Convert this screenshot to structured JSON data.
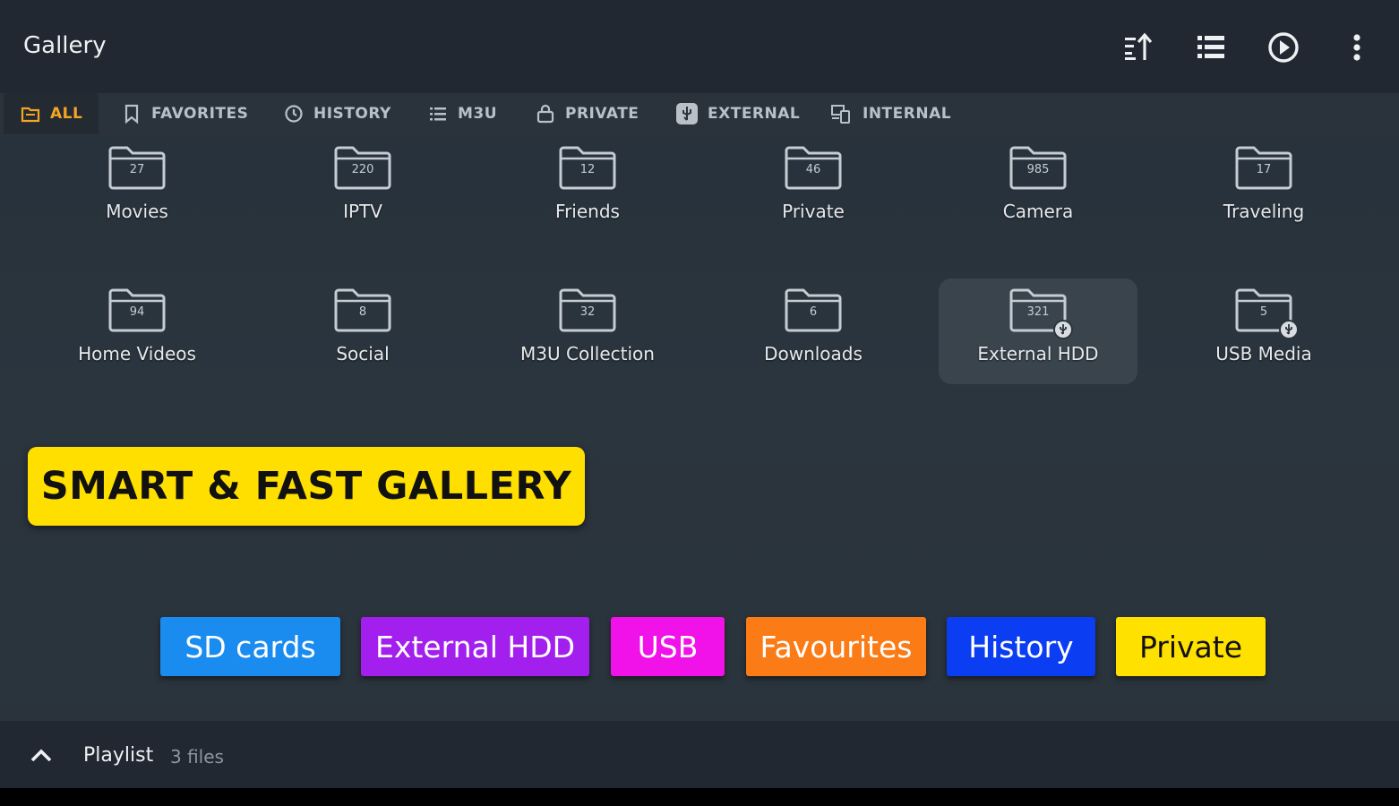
{
  "header": {
    "title": "Gallery",
    "actions": [
      {
        "name": "sort-icon"
      },
      {
        "name": "list-view-icon"
      },
      {
        "name": "play-circle-icon"
      },
      {
        "name": "more-vert-icon"
      }
    ]
  },
  "tabs": [
    {
      "label": "ALL",
      "icon": "folder-icon",
      "active": true
    },
    {
      "label": "FAVORITES",
      "icon": "bookmark-icon"
    },
    {
      "label": "HISTORY",
      "icon": "clock-icon"
    },
    {
      "label": "M3U",
      "icon": "list-icon"
    },
    {
      "label": "PRIVATE",
      "icon": "lock-icon"
    },
    {
      "label": "EXTERNAL",
      "icon": "usb-icon"
    },
    {
      "label": "INTERNAL",
      "icon": "devices-icon"
    }
  ],
  "folders": [
    {
      "name": "Movies",
      "count": "27"
    },
    {
      "name": "IPTV",
      "count": "220"
    },
    {
      "name": "Friends",
      "count": "12"
    },
    {
      "name": "Private",
      "count": "46"
    },
    {
      "name": "Camera",
      "count": "985"
    },
    {
      "name": "Traveling",
      "count": "17"
    },
    {
      "name": "Home Videos",
      "count": "94"
    },
    {
      "name": "Social",
      "count": "8"
    },
    {
      "name": "M3U Collection",
      "count": "32"
    },
    {
      "name": "Downloads",
      "count": "6"
    },
    {
      "name": "External HDD",
      "count": "321",
      "badge": "usb-icon",
      "selected": true
    },
    {
      "name": "USB Media",
      "count": "5",
      "badge": "usb-icon"
    }
  ],
  "banner": {
    "text": "SMART & FAST GALLERY",
    "background": "#ffdf00",
    "color": "#111111"
  },
  "chips": [
    {
      "label": "SD cards",
      "background": "#1a8cf0",
      "color": "#ffffff"
    },
    {
      "label": "External HDD",
      "background": "#a21fee",
      "color": "#ffffff"
    },
    {
      "label": "USB",
      "background": "#f012e8",
      "color": "#ffffff"
    },
    {
      "label": "Favourites",
      "background": "#fb7b17",
      "color": "#ffffff"
    },
    {
      "label": "History",
      "background": "#0b3df2",
      "color": "#ffffff"
    },
    {
      "label": "Private",
      "background": "#ffe100",
      "color": "#111111"
    }
  ],
  "playlist": {
    "title": "Playlist",
    "count": "3 files"
  },
  "colors": {
    "accent": "#f5a524"
  }
}
